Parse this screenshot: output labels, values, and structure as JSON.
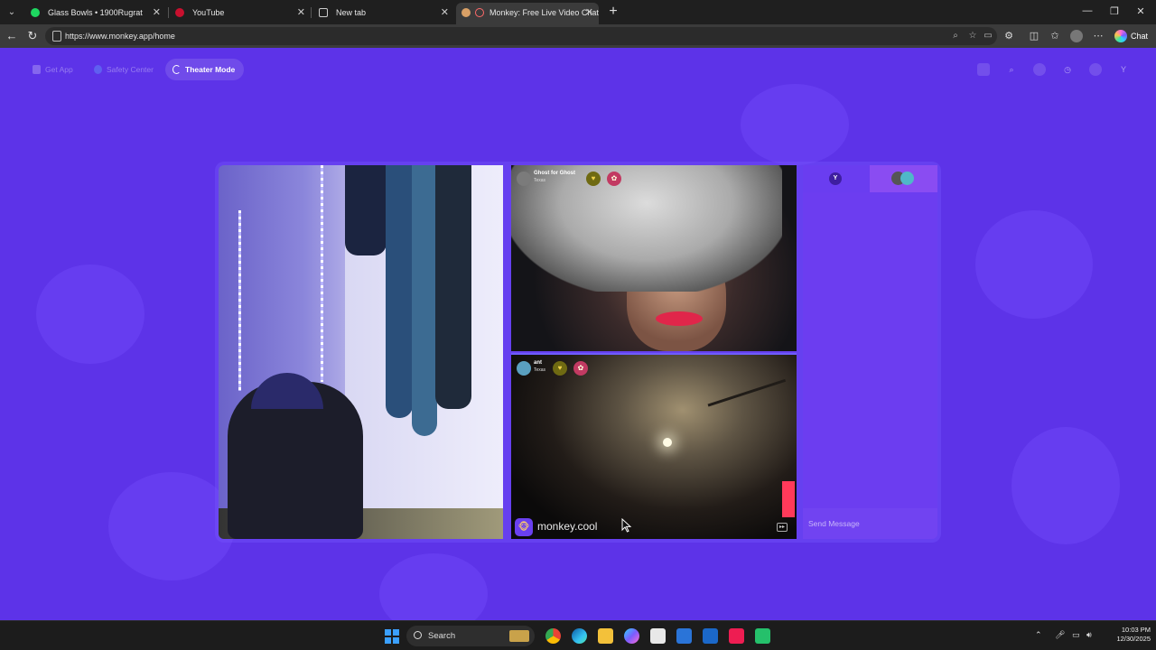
{
  "browser": {
    "tabs": [
      {
        "title": "Glass Bowls • 1900Rugrat",
        "favicon_color": "#1ed760",
        "active": false
      },
      {
        "title": "YouTube",
        "favicon_color": "#ff2a2a",
        "active": false
      },
      {
        "title": "New tab",
        "favicon_color": "#cccccc",
        "active": false
      },
      {
        "title": "Monkey: Free Live Video Chat",
        "favicon_color": "#ff6a6a",
        "active": true
      }
    ],
    "url": "https://www.monkey.app/home",
    "chat_label": "Chat"
  },
  "page": {
    "nav": {
      "get_app": "Get App",
      "safety_center": "Safety Center",
      "theater_mode": "Theater Mode"
    },
    "profile_initial": "Y",
    "peer1": {
      "name": "Ghost for Ghost",
      "location": "Texas"
    },
    "peer2": {
      "name": "ant",
      "location": "Texas"
    },
    "watermark": "monkey.cool",
    "chat": {
      "my_initial": "Y",
      "input_placeholder": "Send Message"
    }
  },
  "taskbar": {
    "search_label": "Search",
    "time": "10:03 PM",
    "date": "12/30/2025"
  },
  "colors": {
    "page_bg": "#5d33e8",
    "chat_panel": "#6c3df0",
    "chat_peers_tab": "#8a4cf2"
  }
}
